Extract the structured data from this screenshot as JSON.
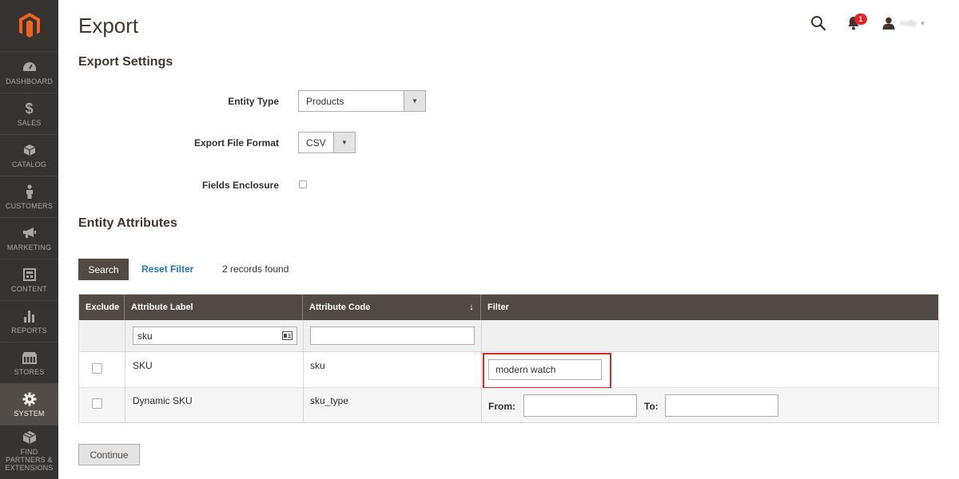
{
  "page": {
    "title": "Export"
  },
  "header": {
    "notification_count": "1",
    "user_name": "rudy"
  },
  "sidebar": {
    "items": [
      {
        "label": "DASHBOARD",
        "icon": "dashboard-icon",
        "active": false
      },
      {
        "label": "SALES",
        "icon": "dollar-icon",
        "active": false
      },
      {
        "label": "CATALOG",
        "icon": "cube-icon",
        "active": false
      },
      {
        "label": "CUSTOMERS",
        "icon": "person-icon",
        "active": false
      },
      {
        "label": "MARKETING",
        "icon": "megaphone-icon",
        "active": false
      },
      {
        "label": "CONTENT",
        "icon": "content-icon",
        "active": false
      },
      {
        "label": "REPORTS",
        "icon": "bar-chart-icon",
        "active": false
      },
      {
        "label": "STORES",
        "icon": "store-icon",
        "active": false
      },
      {
        "label": "SYSTEM",
        "icon": "gear-icon",
        "active": true
      },
      {
        "label": "FIND PARTNERS & EXTENSIONS",
        "icon": "box-icon",
        "active": false
      }
    ]
  },
  "export_settings": {
    "title": "Export Settings",
    "entity_type": {
      "label": "Entity Type",
      "value": "Products"
    },
    "file_format": {
      "label": "Export File Format",
      "value": "CSV"
    },
    "fields_enclosure": {
      "label": "Fields Enclosure",
      "checked": false
    }
  },
  "entity_attributes": {
    "title": "Entity Attributes",
    "search_label": "Search",
    "reset_label": "Reset Filter",
    "records_text": "2 records found",
    "columns": [
      "Exclude",
      "Attribute Label",
      "Attribute Code",
      "Filter"
    ],
    "sort_arrow": "↓",
    "filters": {
      "attribute_label": "sku",
      "attribute_code": ""
    },
    "rows": [
      {
        "label": "SKU",
        "code": "sku",
        "filter_value": "modern watch"
      },
      {
        "label": "Dynamic SKU",
        "code": "sku_type",
        "from_label": "From:",
        "to_label": "To:",
        "from_value": "",
        "to_value": ""
      }
    ]
  },
  "continue_label": "Continue"
}
